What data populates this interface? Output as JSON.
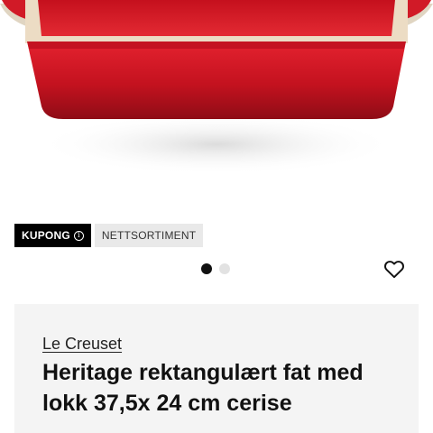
{
  "badges": {
    "coupon_label": "KUPONG",
    "coupon_info_icon": "info-icon",
    "online_range_label": "NETTSORTIMENT"
  },
  "gallery": {
    "image_count": 2,
    "active_index": 0
  },
  "favorite": {
    "icon": "heart-outline-icon"
  },
  "product": {
    "brand": "Le Creuset",
    "title": "Heritage rektangulært fat med lokk 37,5x 24 cm cerise"
  },
  "colors": {
    "dish_red": "#c8102e",
    "badge_dark": "#000000",
    "card_bg": "#f4f4f4"
  }
}
